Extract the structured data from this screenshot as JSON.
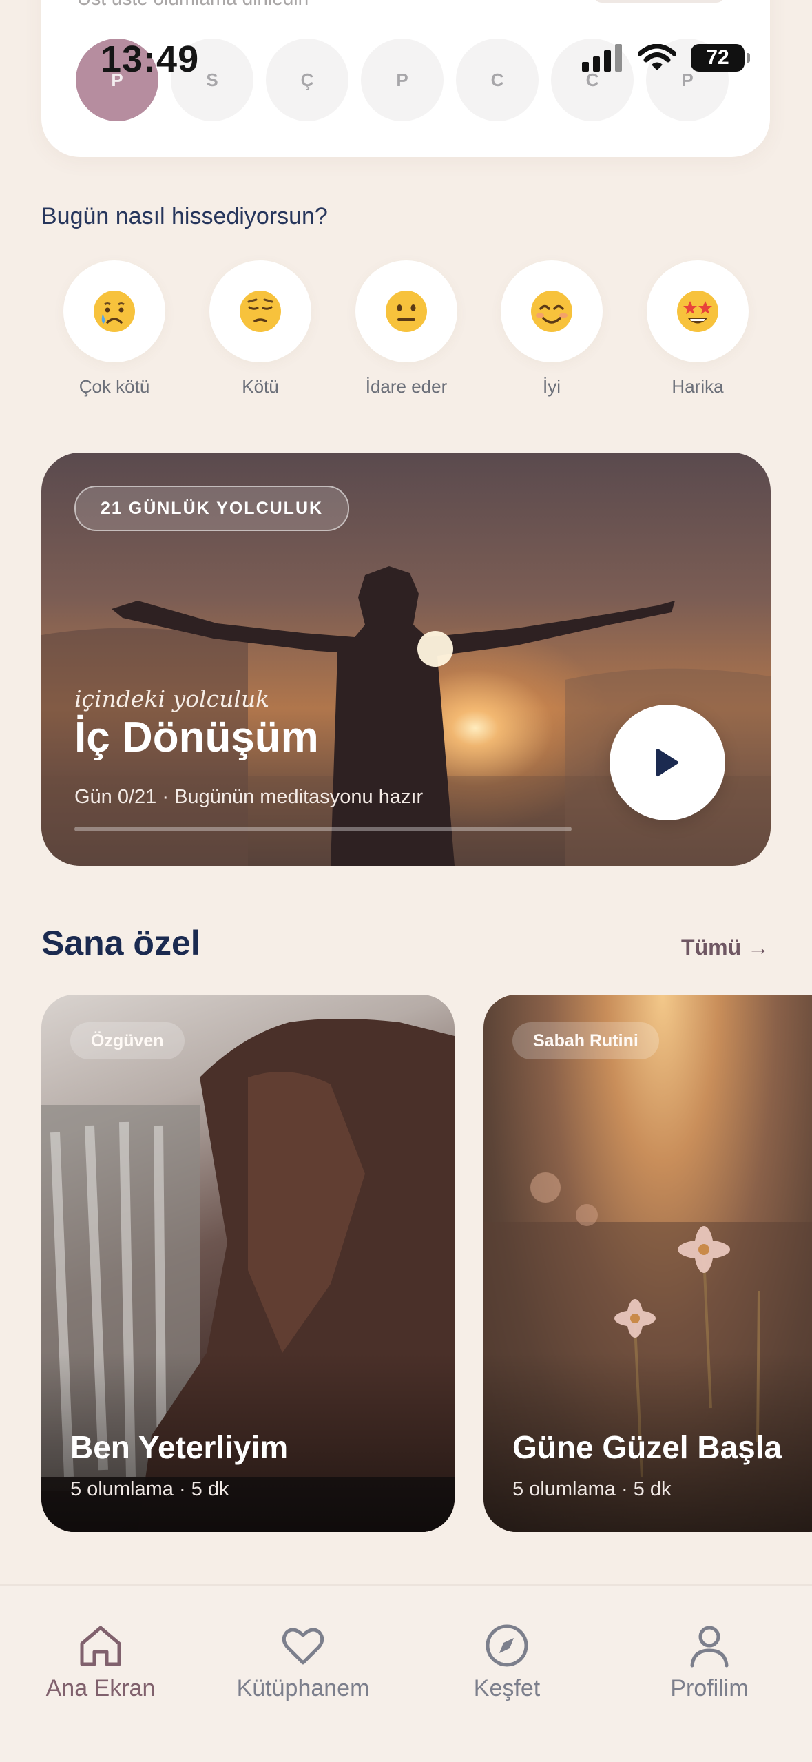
{
  "status_bar": {
    "time": "13:49",
    "battery": "72"
  },
  "week": {
    "hint": "Üst üste olumlama dinledin",
    "days": [
      "P",
      "S",
      "Ç",
      "P",
      "C",
      "C",
      "P"
    ]
  },
  "mood": {
    "question": "Bugün nasıl hissediyorsun?",
    "options": [
      {
        "emoji": "😢",
        "label": "Çok kötü"
      },
      {
        "emoji": "😔",
        "label": "Kötü"
      },
      {
        "emoji": "😐",
        "label": "İdare eder"
      },
      {
        "emoji": "😊",
        "label": "İyi"
      },
      {
        "emoji": "🤩",
        "label": "Harika"
      }
    ]
  },
  "journey": {
    "badge": "21 GÜNLÜK YOLCULUK",
    "script": "içindeki yolculuk",
    "title": "İç Dönüşüm",
    "subtitle": "Gün 0/21 · Bugünün meditasyonu hazır",
    "progress": 0
  },
  "for_you": {
    "title": "Sana özel",
    "see_all": "Tümü →",
    "cards": [
      {
        "tag": "Özgüven",
        "title": "Ben Yeterliyim",
        "meta": "5 olumlama · 5 dk"
      },
      {
        "tag": "Sabah Rutini",
        "title": "Güne Güzel Başla",
        "meta": "5 olumlama · 5 dk"
      }
    ]
  },
  "tabs": [
    {
      "label": "Ana Ekran",
      "icon": "home-icon",
      "active": true
    },
    {
      "label": "Kütüphanem",
      "icon": "heart-icon",
      "active": false
    },
    {
      "label": "Keşfet",
      "icon": "compass-icon",
      "active": false
    },
    {
      "label": "Profilim",
      "icon": "person-icon",
      "active": false
    }
  ],
  "colors": {
    "background": "#f6eee7",
    "accent": "#b68d9f",
    "navy": "#1b2a50",
    "tab_active": "#80616d"
  }
}
